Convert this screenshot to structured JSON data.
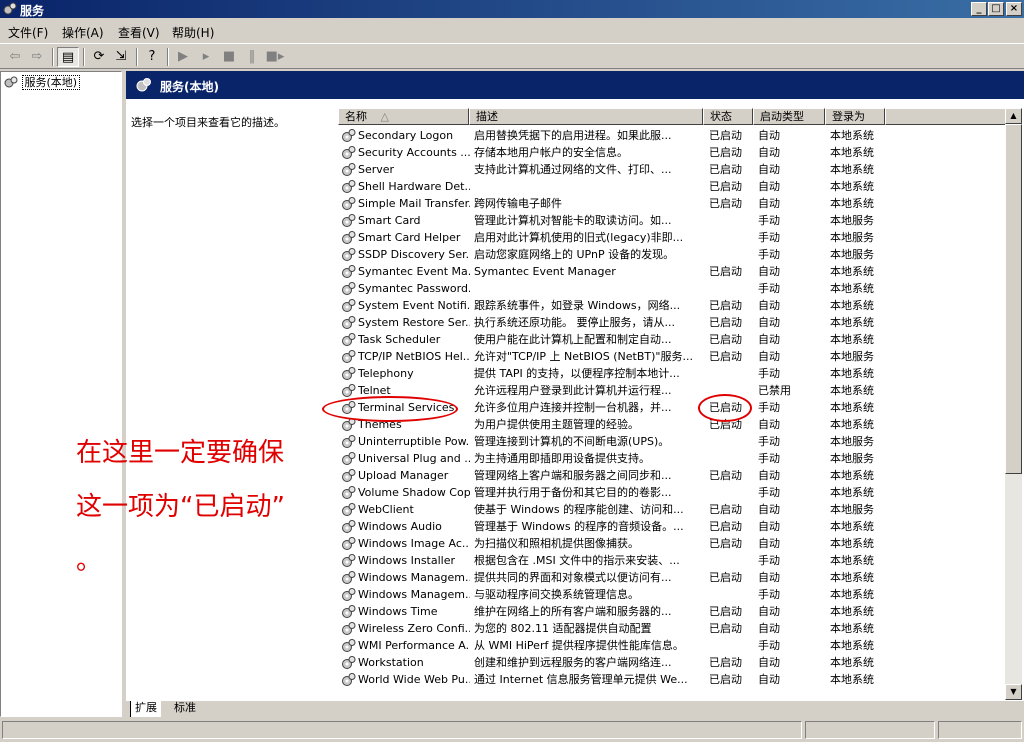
{
  "window": {
    "title": "服务",
    "controls": {
      "minimize": "_",
      "maximize": "□",
      "close": "×"
    }
  },
  "menubar": {
    "items": [
      "文件(F)",
      "操作(A)",
      "查看(V)",
      "帮助(H)"
    ]
  },
  "toolbar": {
    "buttons": [
      "back-icon",
      "forward-icon",
      "show-hide-tree-icon",
      "refresh-icon",
      "export-list-icon",
      "help-icon",
      "play-icon",
      "play-next-icon",
      "stop-icon",
      "pause-icon",
      "restart-icon"
    ]
  },
  "tree": {
    "root_label": "服务(本地)"
  },
  "pane": {
    "title": "服务(本地)",
    "description_prompt": "选择一个项目来查看它的描述。"
  },
  "list": {
    "headers": {
      "name": "名称",
      "desc": "描述",
      "status": "状态",
      "startup": "启动类型",
      "logon": "登录为"
    },
    "sort_indicator": "△",
    "rows": [
      {
        "name": "Secondary Logon",
        "desc": "启用替换凭据下的启用进程。如果此服...",
        "status": "已启动",
        "startup": "自动",
        "logon": "本地系统"
      },
      {
        "name": "Security Accounts ...",
        "desc": "存储本地用户帐户的安全信息。",
        "status": "已启动",
        "startup": "自动",
        "logon": "本地系统"
      },
      {
        "name": "Server",
        "desc": "支持此计算机通过网络的文件、打印、...",
        "status": "已启动",
        "startup": "自动",
        "logon": "本地系统"
      },
      {
        "name": "Shell Hardware Det...",
        "desc": "",
        "status": "已启动",
        "startup": "自动",
        "logon": "本地系统"
      },
      {
        "name": "Simple Mail Transfer...",
        "desc": "跨网传输电子邮件",
        "status": "已启动",
        "startup": "自动",
        "logon": "本地系统"
      },
      {
        "name": "Smart Card",
        "desc": "管理此计算机对智能卡的取读访问。如...",
        "status": "",
        "startup": "手动",
        "logon": "本地服务"
      },
      {
        "name": "Smart Card Helper",
        "desc": "启用对此计算机使用的旧式(legacy)非即...",
        "status": "",
        "startup": "手动",
        "logon": "本地服务"
      },
      {
        "name": "SSDP Discovery Ser...",
        "desc": "启动您家庭网络上的 UPnP 设备的发现。",
        "status": "",
        "startup": "手动",
        "logon": "本地服务"
      },
      {
        "name": "Symantec Event Ma...",
        "desc": "Symantec Event Manager",
        "status": "已启动",
        "startup": "自动",
        "logon": "本地系统"
      },
      {
        "name": "Symantec Password...",
        "desc": "",
        "status": "",
        "startup": "手动",
        "logon": "本地系统"
      },
      {
        "name": "System Event Notifi...",
        "desc": "跟踪系统事件，如登录 Windows，网络...",
        "status": "已启动",
        "startup": "自动",
        "logon": "本地系统"
      },
      {
        "name": "System Restore Ser...",
        "desc": "执行系统还原功能。 要停止服务，请从...",
        "status": "已启动",
        "startup": "自动",
        "logon": "本地系统"
      },
      {
        "name": "Task Scheduler",
        "desc": "使用户能在此计算机上配置和制定自动...",
        "status": "已启动",
        "startup": "自动",
        "logon": "本地系统"
      },
      {
        "name": "TCP/IP NetBIOS Hel...",
        "desc": "允许对\"TCP/IP 上 NetBIOS (NetBT)\"服务...",
        "status": "已启动",
        "startup": "自动",
        "logon": "本地服务"
      },
      {
        "name": "Telephony",
        "desc": "提供 TAPI 的支持，以便程序控制本地计...",
        "status": "",
        "startup": "手动",
        "logon": "本地系统"
      },
      {
        "name": "Telnet",
        "desc": "允许远程用户登录到此计算机并运行程...",
        "status": "",
        "startup": "已禁用",
        "logon": "本地系统"
      },
      {
        "name": "Terminal Services",
        "desc": "允许多位用户连接并控制一台机器，并...",
        "status": "已启动",
        "startup": "手动",
        "logon": "本地系统"
      },
      {
        "name": "Themes",
        "desc": "为用户提供使用主题管理的经验。",
        "status": "已启动",
        "startup": "自动",
        "logon": "本地系统"
      },
      {
        "name": "Uninterruptible Pow...",
        "desc": "管理连接到计算机的不间断电源(UPS)。",
        "status": "",
        "startup": "手动",
        "logon": "本地服务"
      },
      {
        "name": "Universal Plug and ...",
        "desc": "为主持通用即插即用设备提供支持。",
        "status": "",
        "startup": "手动",
        "logon": "本地服务"
      },
      {
        "name": "Upload Manager",
        "desc": "管理网络上客户端和服务器之间同步和...",
        "status": "已启动",
        "startup": "自动",
        "logon": "本地系统"
      },
      {
        "name": "Volume Shadow Copy",
        "desc": "管理并执行用于备份和其它目的的卷影...",
        "status": "",
        "startup": "手动",
        "logon": "本地系统"
      },
      {
        "name": "WebClient",
        "desc": "使基于 Windows 的程序能创建、访问和...",
        "status": "已启动",
        "startup": "自动",
        "logon": "本地服务"
      },
      {
        "name": "Windows Audio",
        "desc": "管理基于 Windows 的程序的音频设备。...",
        "status": "已启动",
        "startup": "自动",
        "logon": "本地系统"
      },
      {
        "name": "Windows Image Ac...",
        "desc": "为扫描仪和照相机提供图像捕获。",
        "status": "已启动",
        "startup": "自动",
        "logon": "本地系统"
      },
      {
        "name": "Windows Installer",
        "desc": "根据包含在 .MSI 文件中的指示来安装、...",
        "status": "",
        "startup": "手动",
        "logon": "本地系统"
      },
      {
        "name": "Windows Managem...",
        "desc": "提供共同的界面和对象模式以便访问有...",
        "status": "已启动",
        "startup": "自动",
        "logon": "本地系统"
      },
      {
        "name": "Windows Managem...",
        "desc": "与驱动程序间交换系统管理信息。",
        "status": "",
        "startup": "手动",
        "logon": "本地系统"
      },
      {
        "name": "Windows Time",
        "desc": "维护在网络上的所有客户端和服务器的...",
        "status": "已启动",
        "startup": "自动",
        "logon": "本地系统"
      },
      {
        "name": "Wireless Zero Confi...",
        "desc": "为您的 802.11 适配器提供自动配置",
        "status": "已启动",
        "startup": "自动",
        "logon": "本地系统"
      },
      {
        "name": "WMI Performance A...",
        "desc": "从 WMI HiPerf 提供程序提供性能库信息。",
        "status": "",
        "startup": "手动",
        "logon": "本地系统"
      },
      {
        "name": "Workstation",
        "desc": "创建和维护到远程服务的客户端网络连...",
        "status": "已启动",
        "startup": "自动",
        "logon": "本地系统"
      },
      {
        "name": "World Wide Web Pu...",
        "desc": "通过 Internet 信息服务管理单元提供 We...",
        "status": "已启动",
        "startup": "自动",
        "logon": "本地系统"
      }
    ]
  },
  "tabs": [
    "扩展",
    "标准"
  ],
  "annotation": {
    "line1": "在这里一定要确保",
    "line2": "这一项为“已启动”",
    "line3": "。",
    "color": "#e00000"
  }
}
